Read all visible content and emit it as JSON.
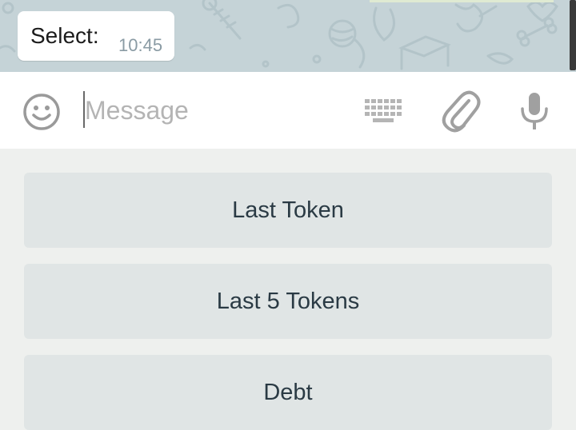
{
  "message": {
    "text": "Select:",
    "time": "10:45"
  },
  "composer": {
    "placeholder": "Message",
    "icons": {
      "emoji": "emoji-icon",
      "keyboard": "keyboard-icon",
      "attach": "paperclip-icon",
      "mic": "microphone-icon"
    }
  },
  "reply_keyboard": {
    "buttons": [
      {
        "label": "Last Token"
      },
      {
        "label": "Last 5 Tokens"
      },
      {
        "label": "Debt"
      }
    ]
  },
  "colors": {
    "chat_background": "#c5d3d7",
    "bubble": "#ffffff",
    "button": "#e0e5e5",
    "button_text": "#2a3a44",
    "icon_gray": "#9a9a9a"
  }
}
